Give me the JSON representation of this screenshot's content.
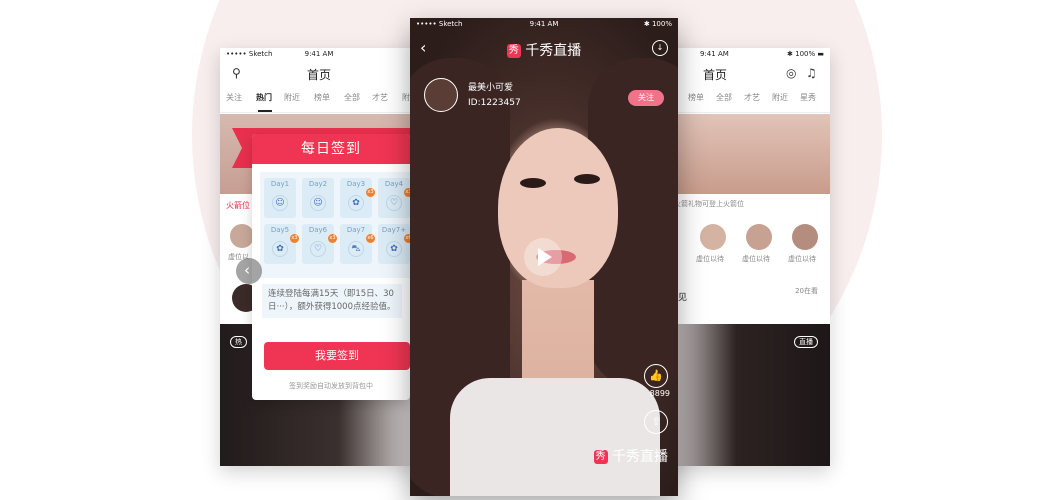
{
  "left": {
    "status_carrier": "••••• Sketch",
    "status_time": "9:41 AM",
    "title": "首页",
    "tabs": [
      "关注",
      "热门",
      "附近",
      "榜单",
      "全部",
      "才艺",
      "附"
    ],
    "active_tab": "热门",
    "fragment_rocket": "火箭位",
    "fragment_placeholder": "虚位以",
    "tag_hot": "热"
  },
  "signin": {
    "title": "每日签到",
    "days": [
      {
        "label": "Day1",
        "icon": "☺",
        "badge": ""
      },
      {
        "label": "Day2",
        "icon": "☺",
        "badge": ""
      },
      {
        "label": "Day3",
        "icon": "✿",
        "badge": "x3"
      },
      {
        "label": "Day4",
        "icon": "♡",
        "badge": "x3"
      },
      {
        "label": "Day5",
        "icon": "✿",
        "badge": "x3"
      },
      {
        "label": "Day6",
        "icon": "♡",
        "badge": "x3"
      },
      {
        "label": "Day7",
        "icon": "⛍",
        "badge": "x6"
      },
      {
        "label": "Day7+",
        "icon": "✿",
        "badge": "x6"
      }
    ],
    "description": "连续登陆每满15天（即15日、30日···），额外获得1000点经验值。",
    "button": "我要签到",
    "note": "签到奖励自动发放到背包中"
  },
  "center": {
    "status_carrier": "••••• Sketch",
    "status_time": "9:41 AM",
    "status_battery": "✱ 100%",
    "brand_logo_char": "秀",
    "brand": "千秀直播",
    "host_name": "最美小可爱",
    "host_id": "ID:1223457",
    "follow": "关注",
    "likes": "8899",
    "watermark": "千秀直播"
  },
  "right": {
    "status_time": "9:41 AM",
    "status_battery": "✱ 100% ▬",
    "title": "首页",
    "tabs": [
      "榜单",
      "全部",
      "才艺",
      "附近",
      "星秀"
    ],
    "rocket_text": "火箭礼物可登上火箭位",
    "placeholders": [
      "虚位以待",
      "虚位以待",
      "虚位以待"
    ],
    "viewers": "20在看",
    "section_fragment": "见",
    "live_tag": "直播"
  },
  "colors": {
    "accent": "#ef3553",
    "follow_pink": "#f1738a",
    "circle_bg": "#f8eeee"
  }
}
